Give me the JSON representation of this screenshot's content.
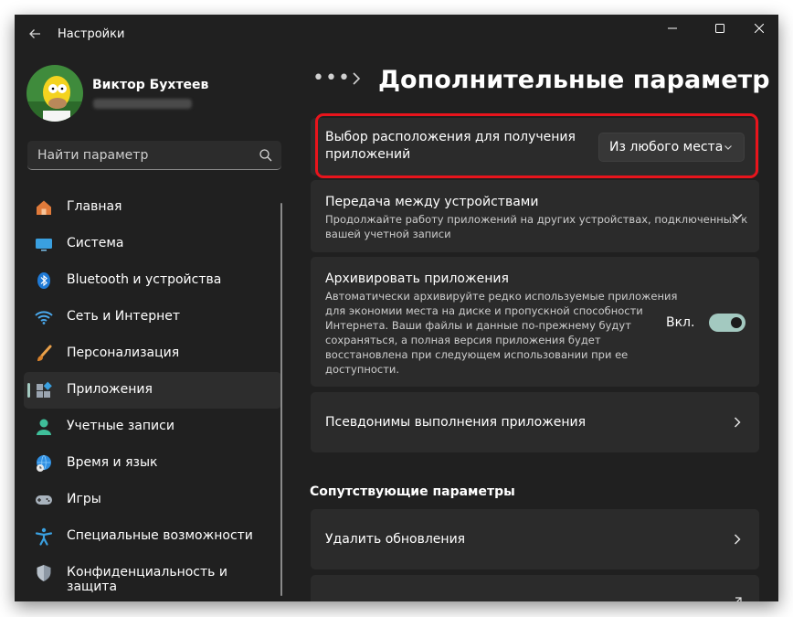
{
  "window": {
    "title": "Настройки",
    "controls": {
      "minimize": "minimize-icon",
      "maximize": "maximize-icon",
      "close": "close-icon"
    }
  },
  "profile": {
    "name": "Виктор Бухтеев",
    "email_redacted": true
  },
  "search": {
    "placeholder": "Найти параметр",
    "icon": "search-icon"
  },
  "sidebar": {
    "items": [
      {
        "label": "Главная",
        "icon": "home-icon"
      },
      {
        "label": "Система",
        "icon": "monitor-icon"
      },
      {
        "label": "Bluetooth и устройства",
        "icon": "bluetooth-icon"
      },
      {
        "label": "Сеть и Интернет",
        "icon": "wifi-icon"
      },
      {
        "label": "Персонализация",
        "icon": "brush-icon"
      },
      {
        "label": "Приложения",
        "icon": "apps-icon",
        "active": true
      },
      {
        "label": "Учетные записи",
        "icon": "person-icon"
      },
      {
        "label": "Время и язык",
        "icon": "globe-clock-icon"
      },
      {
        "label": "Игры",
        "icon": "gamepad-icon"
      },
      {
        "label": "Специальные возможности",
        "icon": "accessibility-icon"
      },
      {
        "label": "Конфиденциальность и защита",
        "icon": "shield-icon"
      }
    ]
  },
  "main": {
    "breadcrumb_more": "•••",
    "title": "Дополнительные параметры пр",
    "app_source": {
      "title_line1": "Выбор расположения для получения",
      "title_line2": "приложений",
      "selected": "Из любого места"
    },
    "share_across_devices": {
      "title": "Передача между устройствами",
      "desc_line1": "Продолжайте работу приложений на других устройствах, подключенных к",
      "desc_line2": "вашей учетной записи"
    },
    "archive_apps": {
      "title": "Архивировать приложения",
      "desc_lines": [
        "Автоматически архивируйте редко используемые приложения",
        "для экономии места на диске и пропускной способности",
        "Интернета. Ваши файлы и данные по-прежнему будут",
        "сохраняться, а полная версия приложения будет",
        "восстановлена при следующем использовании при ее",
        "доступности."
      ],
      "toggle_label": "Вкл.",
      "toggle_on": true
    },
    "app_aliases": {
      "title": "Псевдонимы выполнения приложения"
    },
    "related_heading": "Сопутствующие параметры",
    "uninstall_updates": {
      "title": "Удалить обновления"
    }
  },
  "colors": {
    "accent": "#a3c9c0",
    "highlight": "#e8141c",
    "background": "#202020",
    "card": "#2b2b2b"
  }
}
